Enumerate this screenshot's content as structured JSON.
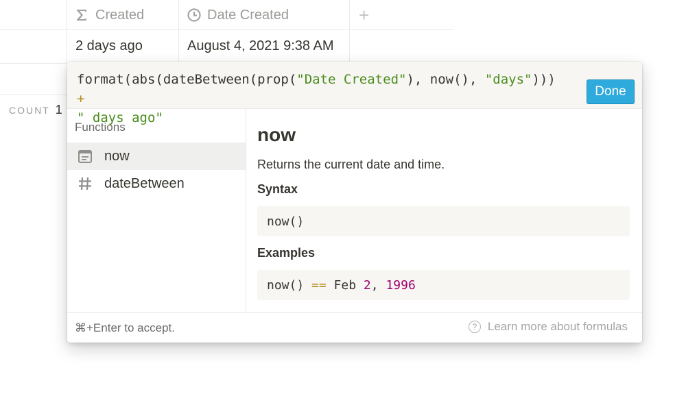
{
  "table": {
    "columns": [
      {
        "label": "Created",
        "icon": "sigma-icon"
      },
      {
        "label": "Date Created",
        "icon": "clock-icon"
      }
    ],
    "add_column_symbol": "+",
    "row": {
      "created": "2 days ago",
      "date_created": "August 4, 2021 9:38 AM"
    },
    "count_label": "COUNT",
    "count_value": "1"
  },
  "editor": {
    "formula_parts": {
      "p1": "format(abs(dateBetween(prop(",
      "s1": "\"Date Created\"",
      "p2": "), now(), ",
      "s2": "\"days\"",
      "p3": "))) ",
      "op": "+",
      "s3": "\" days ago\""
    },
    "done_label": "Done"
  },
  "functions": {
    "title": "Functions",
    "items": [
      {
        "label": "now",
        "icon": "calendar-icon",
        "active": true
      },
      {
        "label": "dateBetween",
        "icon": "hash-icon",
        "active": false
      }
    ]
  },
  "detail": {
    "name": "now",
    "description": "Returns the current date and time.",
    "syntax_title": "Syntax",
    "syntax_code": "now()",
    "examples_title": "Examples",
    "example": {
      "a": "now() ",
      "op": "==",
      "b": " Feb ",
      "n1": "2",
      "c": ", ",
      "n2": "1996"
    }
  },
  "footer": {
    "hint": "⌘+Enter to accept.",
    "learn_more": "Learn more about formulas",
    "help_icon": "?"
  },
  "colors": {
    "accent": "#2eaadc",
    "string": "#4a8c1c",
    "operator": "#b78a19",
    "number": "#a0006e"
  }
}
